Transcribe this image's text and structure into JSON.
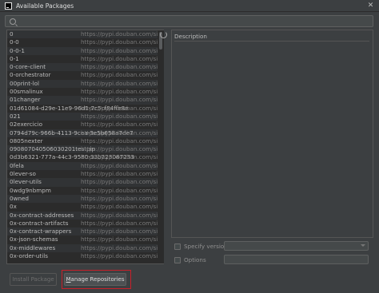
{
  "window": {
    "title": "Available Packages"
  },
  "search": {
    "value": "",
    "placeholder": ""
  },
  "packages": [
    {
      "name": "0",
      "repo": "https://pypi.douban.com/simple/"
    },
    {
      "name": "0-0",
      "repo": "https://pypi.douban.com/simple/"
    },
    {
      "name": "0-0-1",
      "repo": "https://pypi.douban.com/simple/"
    },
    {
      "name": "0-1",
      "repo": "https://pypi.douban.com/simple/"
    },
    {
      "name": "0-core-client",
      "repo": "https://pypi.douban.com/simple/"
    },
    {
      "name": "0-orchestrator",
      "repo": "https://pypi.douban.com/simple/"
    },
    {
      "name": "00print-lol",
      "repo": "https://pypi.douban.com/simple/"
    },
    {
      "name": "00smalinux",
      "repo": "https://pypi.douban.com/simple/"
    },
    {
      "name": "01changer",
      "repo": "https://pypi.douban.com/simple/"
    },
    {
      "name": "01d61084-d29e-11e9-96d1-7c5cf84ffe8e",
      "repo": "https://pypi.douban.com/simple/"
    },
    {
      "name": "021",
      "repo": "https://pypi.douban.com/simple/"
    },
    {
      "name": "02exercicio",
      "repo": "https://pypi.douban.com/simple/"
    },
    {
      "name": "0794d79c-966b-4113-9cea-3e5b658a7de7",
      "repo": "https://pypi.douban.com/simple/"
    },
    {
      "name": "0805nexter",
      "repo": "https://pypi.douban.com/simple/"
    },
    {
      "name": "090807040506030201testpip",
      "repo": "https://pypi.douban.com/simple/"
    },
    {
      "name": "0d3b6321-777a-44c3-9580-33b223087233",
      "repo": "https://pypi.douban.com/simple/"
    },
    {
      "name": "0fela",
      "repo": "https://pypi.douban.com/simple/"
    },
    {
      "name": "0lever-so",
      "repo": "https://pypi.douban.com/simple/"
    },
    {
      "name": "0lever-utils",
      "repo": "https://pypi.douban.com/simple/"
    },
    {
      "name": "0wdg9nbmpm",
      "repo": "https://pypi.douban.com/simple/"
    },
    {
      "name": "0wned",
      "repo": "https://pypi.douban.com/simple/"
    },
    {
      "name": "0x",
      "repo": "https://pypi.douban.com/simple/"
    },
    {
      "name": "0x-contract-addresses",
      "repo": "https://pypi.douban.com/simple/"
    },
    {
      "name": "0x-contract-artifacts",
      "repo": "https://pypi.douban.com/simple/"
    },
    {
      "name": "0x-contract-wrappers",
      "repo": "https://pypi.douban.com/simple/"
    },
    {
      "name": "0x-json-schemas",
      "repo": "https://pypi.douban.com/simple/"
    },
    {
      "name": "0x-middlewares",
      "repo": "https://pypi.douban.com/simple/"
    },
    {
      "name": "0x-order-utils",
      "repo": "https://pypi.douban.com/simple/"
    }
  ],
  "description": {
    "label": "Description"
  },
  "options": {
    "specify_version_label": "Specify version",
    "options_label": "Options"
  },
  "buttons": {
    "install_label": "Install Package",
    "manage_prefix": "",
    "manage_underline": "M",
    "manage_rest": "anage Repositories"
  },
  "colors": {
    "background": "#3c3f41",
    "list_background": "#2b2b2b",
    "highlight": "#c8202a"
  }
}
